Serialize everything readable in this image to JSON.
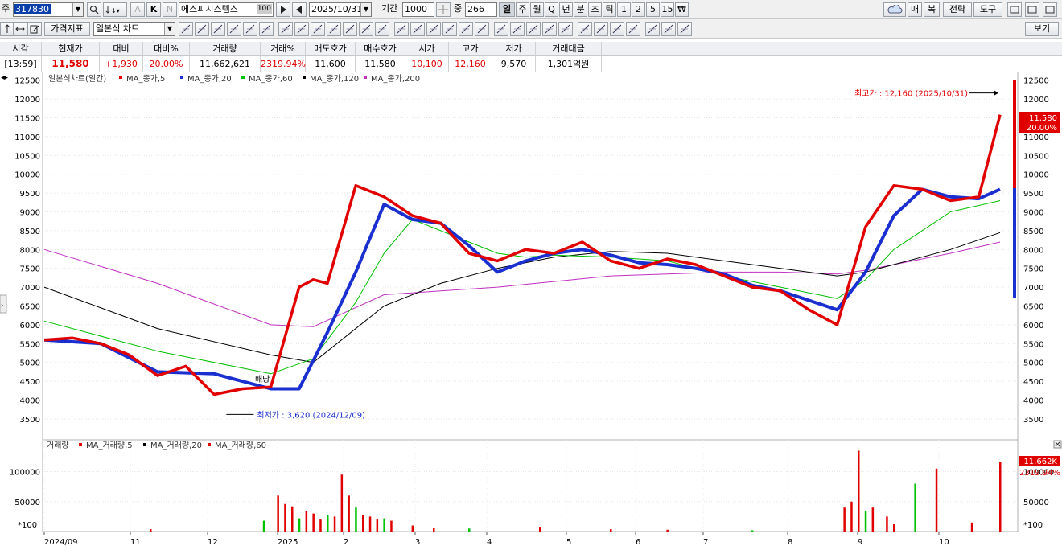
{
  "toolbar1": {
    "market_label": "주",
    "code": "317830",
    "k_label": "K",
    "n_label": "N",
    "a_label": "A",
    "stock_name": "에스피시스템스",
    "stock_badge": "100",
    "date": "2025/10/31",
    "period_label": "기간",
    "period_value": "1000",
    "count_label": "중",
    "count_value": "266",
    "periods": [
      "일",
      "주",
      "월",
      "Q",
      "년",
      "분",
      "초",
      "틱",
      "1",
      "2",
      "5",
      "15",
      "₩"
    ],
    "right_buttons": [
      "매",
      "복",
      "전략",
      "도구"
    ]
  },
  "toolbar2": {
    "price_indicator": "가격지표",
    "chart_type": "일본식 차트",
    "view_button": "보기"
  },
  "quote": {
    "headers": [
      "시각",
      "현재가",
      "대비",
      "대비%",
      "거래량",
      "거래%",
      "매도호가",
      "매수호가",
      "시가",
      "고가",
      "저가",
      "거래대금"
    ],
    "values": [
      "[13:59]",
      "11,580",
      "+1,930",
      "20.00%",
      "11,662,621",
      "2319.94%",
      "11,600",
      "11,580",
      "10,100",
      "12,160",
      "9,570",
      "1,301억원"
    ]
  },
  "colors": {
    "candle_up": "#e00000",
    "candle_down": "#1a2fd0",
    "ma5": "#e00000",
    "ma20": "#1a2fd0",
    "ma60": "#00c000",
    "ma120": "#000000",
    "ma200": "#c030c0"
  },
  "chart_data": [
    {
      "type": "line",
      "title": "일본식차트(일간)",
      "legend": [
        "MA_종가,5",
        "MA_종가,20",
        "MA_종가,60",
        "MA_종가,120",
        "MA_종가,200"
      ],
      "x_ticks": [
        "2024/09",
        "11",
        "12",
        "2025",
        "2",
        "3",
        "4",
        "5",
        "6",
        "7",
        "8",
        "9",
        "10"
      ],
      "ylim": [
        3200,
        12600
      ],
      "y_ticks": [
        3500,
        4000,
        4500,
        5000,
        5500,
        6000,
        6500,
        7000,
        7500,
        8000,
        8500,
        9000,
        9500,
        10000,
        10500,
        11000,
        11500,
        12000,
        12500
      ],
      "series": [
        {
          "name": "MA_종가,5",
          "x": [
            0,
            8,
            16,
            24,
            32,
            40,
            48,
            56,
            64,
            72,
            76,
            80,
            88,
            96,
            104,
            112,
            120,
            128,
            136,
            144,
            152,
            160,
            168,
            176,
            184,
            192,
            200,
            208,
            216,
            224,
            232,
            240,
            248,
            256,
            264,
            270
          ],
          "y": [
            5600,
            5650,
            5500,
            5200,
            4650,
            4900,
            4150,
            4300,
            4350,
            7000,
            7200,
            7100,
            9700,
            9400,
            8900,
            8700,
            7900,
            7700,
            8000,
            7900,
            8200,
            7700,
            7500,
            7750,
            7600,
            7300,
            7000,
            6900,
            6400,
            6000,
            8600,
            9700,
            9600,
            9300,
            9400,
            11580
          ]
        },
        {
          "name": "MA_종가,20",
          "x": [
            0,
            16,
            32,
            48,
            64,
            72,
            80,
            88,
            96,
            104,
            112,
            120,
            128,
            136,
            144,
            152,
            160,
            168,
            176,
            184,
            192,
            200,
            208,
            216,
            224,
            232,
            240,
            248,
            256,
            264,
            270
          ],
          "y": [
            5600,
            5500,
            4750,
            4700,
            4300,
            4300,
            5800,
            7400,
            9200,
            8800,
            8700,
            8100,
            7400,
            7700,
            7900,
            8000,
            7850,
            7650,
            7600,
            7500,
            7350,
            7050,
            6900,
            6650,
            6400,
            7400,
            8900,
            9600,
            9400,
            9350,
            9600
          ]
        },
        {
          "name": "MA_종가,60",
          "x": [
            0,
            32,
            64,
            76,
            88,
            96,
            104,
            112,
            120,
            128,
            136,
            144,
            160,
            176,
            192,
            208,
            224,
            232,
            240,
            256,
            270
          ],
          "y": [
            6100,
            5300,
            4700,
            5100,
            6600,
            7900,
            8800,
            8500,
            8200,
            7900,
            7800,
            7850,
            7800,
            7700,
            7300,
            7000,
            6700,
            7200,
            8000,
            9000,
            9300
          ]
        },
        {
          "name": "MA_종가,120",
          "x": [
            0,
            32,
            64,
            76,
            96,
            112,
            128,
            144,
            160,
            176,
            192,
            208,
            224,
            232,
            240,
            256,
            270
          ],
          "y": [
            7000,
            5900,
            5200,
            5000,
            6500,
            7100,
            7500,
            7800,
            7950,
            7900,
            7700,
            7500,
            7300,
            7400,
            7600,
            8000,
            8450
          ]
        },
        {
          "name": "MA_종가,200",
          "x": [
            0,
            32,
            64,
            76,
            96,
            112,
            128,
            144,
            160,
            176,
            192,
            208,
            224,
            232,
            240,
            256,
            270
          ],
          "y": [
            8000,
            7100,
            6000,
            5950,
            6800,
            6900,
            7000,
            7150,
            7300,
            7350,
            7400,
            7400,
            7350,
            7450,
            7600,
            7900,
            8200
          ]
        }
      ],
      "annotations": [
        {
          "text": "최고가 : 12,160 (2025/10/31)",
          "x": 270,
          "y": 12160
        },
        {
          "text": "최저가 : 3,620 (2024/12/09)",
          "x": 51,
          "y": 3620
        },
        {
          "text": "배당",
          "x": 63,
          "y": 4550
        }
      ],
      "last_price": "11,580",
      "last_change_pct": "20.00%",
      "grid": true
    },
    {
      "type": "bar",
      "title": "거래량",
      "legend": [
        "MA_거래량,5",
        "MA_거래량,20",
        "MA_거래량,60"
      ],
      "ylim": [
        0,
        145000
      ],
      "y_ticks": [
        50000,
        100000
      ],
      "scale_note": "*100",
      "x": [
        30,
        62,
        66,
        68,
        70,
        72,
        74,
        76,
        78,
        80,
        82,
        84,
        86,
        88,
        90,
        92,
        94,
        96,
        98,
        104,
        110,
        120,
        140,
        160,
        176,
        200,
        226,
        228,
        230,
        232,
        234,
        238,
        240,
        246,
        252,
        262,
        270
      ],
      "values": [
        4000,
        18000,
        60000,
        46000,
        42000,
        22000,
        35000,
        30000,
        20000,
        28000,
        25000,
        95000,
        60000,
        40000,
        28000,
        25000,
        20000,
        22000,
        18000,
        10000,
        6000,
        5000,
        8000,
        4000,
        3000,
        2000,
        40000,
        50000,
        135000,
        35000,
        40000,
        25000,
        12000,
        80000,
        105000,
        15000,
        116626
      ],
      "last_volume": "11,662K",
      "last_volume_pct": "2319.94%"
    }
  ]
}
